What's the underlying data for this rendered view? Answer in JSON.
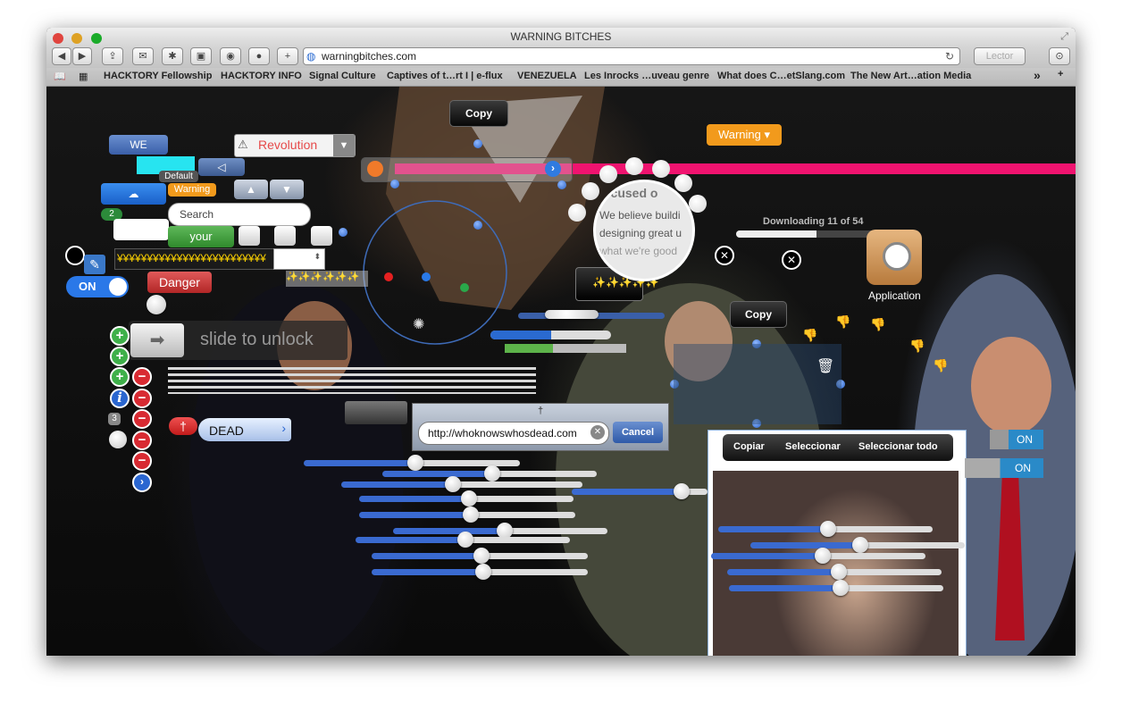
{
  "window": {
    "title": "WARNING BITCHES"
  },
  "toolbar": {
    "url": "warningbitches.com",
    "reader": "Lector",
    "add": "+"
  },
  "bookmarks": [
    "HACKTORY Fellowship",
    "HACKTORY INFO",
    "Signal Culture",
    "Captives of t…rt I | e-flux",
    "VENEZUELA",
    "Les Inrocks …uveau genre",
    "What does C…etSlang.com",
    "The New Art…ation Media"
  ],
  "bookmarks_more": "»",
  "widgets": {
    "we": "WE",
    "revolution": "Revolution",
    "warning_top": "Warning",
    "default": "Default",
    "warning_small": "Warning",
    "badge_2": "2",
    "search_placeholder": "Search",
    "your": "your",
    "yyy": "¥¥¥¥¥¥¥¥¥¥¥¥¥¥¥¥¥¥¥¥¥¥¥¥¥",
    "on": "ON",
    "danger": "Danger",
    "slide": "slide to unlock",
    "dead": "DEAD",
    "badge_3": "3",
    "copy1": "Copy",
    "copy2": "Copy",
    "sparkle1": "✨✨✨✨✨✨",
    "sparkle2": "✨✨✨✨✨",
    "downloading": "Downloading 11 of 54",
    "application": "Application",
    "mag_lines": [
      "ocused o",
      "We believe buildi",
      "designing great u",
      "what we're good"
    ],
    "url_field": "http://whoknowswhosdead.com",
    "cancel": "Cancel",
    "menu": [
      "Copiar",
      "Seleccionar",
      "Seleccionar todo"
    ],
    "on_right1": "ON",
    "on_right2": "ON",
    "arrow_left": "◁",
    "dagger": "†"
  },
  "progress": {
    "downloading": 0.55,
    "bar_blue": 0.5,
    "bar_green": 0.4
  }
}
